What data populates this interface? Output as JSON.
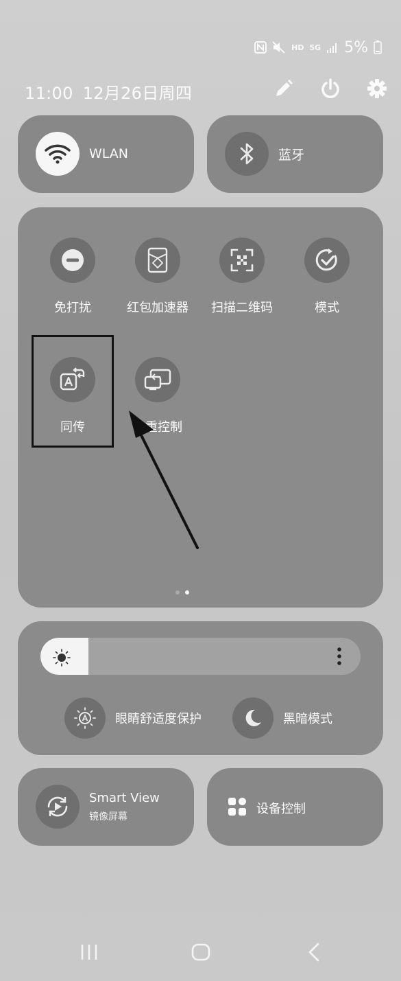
{
  "status_bar": {
    "nfc": "nfc-icon",
    "mute": "mute-icon",
    "hd": "HD",
    "network": "5G",
    "signal": "signal-icon",
    "battery_percent": "5%",
    "battery": "battery-icon"
  },
  "header": {
    "time": "11:00",
    "date": "12月26日周四"
  },
  "tiles": {
    "wlan": {
      "label": "WLAN",
      "active": true
    },
    "bluetooth": {
      "label": "蓝牙",
      "active": false
    }
  },
  "quick_settings": [
    {
      "id": "dnd",
      "label": "免打扰",
      "icon": "minus-circle-icon"
    },
    {
      "id": "red-packet",
      "label": "红包加速器",
      "icon": "red-packet-icon"
    },
    {
      "id": "scan-qr",
      "label": "扫描二维码",
      "icon": "qr-scan-icon"
    },
    {
      "id": "mode",
      "label": "模式",
      "icon": "mode-check-icon"
    },
    {
      "id": "interpreter",
      "label": "同传",
      "icon": "translate-icon"
    },
    {
      "id": "multi-control",
      "label": "多重控制",
      "icon": "multi-device-icon"
    }
  ],
  "pagination": {
    "pages": 2,
    "current": 2
  },
  "brightness": {
    "level": 0.15
  },
  "display_toggles": {
    "eye_comfort": {
      "label": "眼睛舒适度保护"
    },
    "dark_mode": {
      "label": "黑暗模式"
    }
  },
  "bottom_tiles": {
    "smart_view": {
      "title": "Smart View",
      "subtitle": "镜像屏幕"
    },
    "device_control": {
      "label": "设备控制"
    }
  },
  "colors": {
    "tile_bg": "#888888",
    "icon_circle": "#6f6f6f",
    "active": "#f6f6f6",
    "highlight": "#111111"
  }
}
